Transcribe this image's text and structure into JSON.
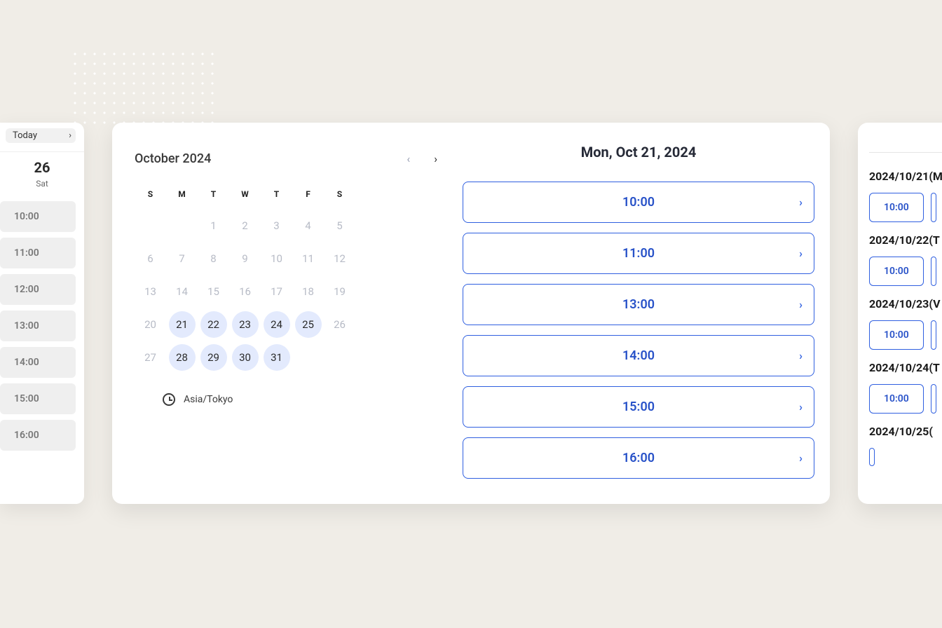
{
  "leftPanel": {
    "todayLabel": "Today",
    "dateNum": "26",
    "dateDay": "Sat",
    "slots": [
      "10:00",
      "11:00",
      "12:00",
      "13:00",
      "14:00",
      "15:00",
      "16:00"
    ]
  },
  "centerPanel": {
    "calendarTitle": "October 2024",
    "dow": [
      "S",
      "M",
      "T",
      "W",
      "T",
      "F",
      "S"
    ],
    "weeks": [
      [
        {
          "n": "",
          "a": false
        },
        {
          "n": "",
          "a": false
        },
        {
          "n": "1",
          "a": false
        },
        {
          "n": "2",
          "a": false
        },
        {
          "n": "3",
          "a": false
        },
        {
          "n": "4",
          "a": false
        },
        {
          "n": "5",
          "a": false
        }
      ],
      [
        {
          "n": "6",
          "a": false
        },
        {
          "n": "7",
          "a": false
        },
        {
          "n": "8",
          "a": false
        },
        {
          "n": "9",
          "a": false
        },
        {
          "n": "10",
          "a": false
        },
        {
          "n": "11",
          "a": false
        },
        {
          "n": "12",
          "a": false
        }
      ],
      [
        {
          "n": "13",
          "a": false
        },
        {
          "n": "14",
          "a": false
        },
        {
          "n": "15",
          "a": false
        },
        {
          "n": "16",
          "a": false
        },
        {
          "n": "17",
          "a": false
        },
        {
          "n": "18",
          "a": false
        },
        {
          "n": "19",
          "a": false
        }
      ],
      [
        {
          "n": "20",
          "a": false
        },
        {
          "n": "21",
          "a": true
        },
        {
          "n": "22",
          "a": true
        },
        {
          "n": "23",
          "a": true
        },
        {
          "n": "24",
          "a": true
        },
        {
          "n": "25",
          "a": true
        },
        {
          "n": "26",
          "a": false
        }
      ],
      [
        {
          "n": "27",
          "a": false
        },
        {
          "n": "28",
          "a": true
        },
        {
          "n": "29",
          "a": true
        },
        {
          "n": "30",
          "a": true
        },
        {
          "n": "31",
          "a": true
        },
        {
          "n": "",
          "a": false
        },
        {
          "n": "",
          "a": false
        }
      ]
    ],
    "timezone": "Asia/Tokyo",
    "selectedDateHeading": "Mon, Oct 21, 2024",
    "timeSlots": [
      "10:00",
      "11:00",
      "13:00",
      "14:00",
      "15:00",
      "16:00"
    ]
  },
  "rightPanel": {
    "days": [
      {
        "label": "2024/10/21(M",
        "chips": [
          "10:00"
        ]
      },
      {
        "label": "2024/10/22(T",
        "chips": [
          "10:00"
        ]
      },
      {
        "label": "2024/10/23(V",
        "chips": [
          "10:00"
        ]
      },
      {
        "label": "2024/10/24(T",
        "chips": [
          "10:00"
        ]
      },
      {
        "label": "2024/10/25(",
        "chips": []
      }
    ]
  },
  "glyphs": {
    "chevRight": "›",
    "chevLeft": "‹"
  }
}
